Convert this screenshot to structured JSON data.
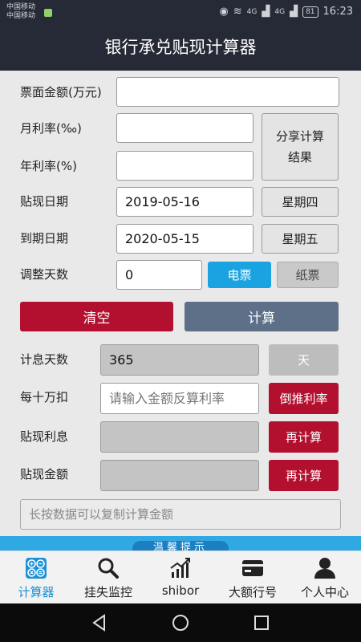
{
  "status_bar": {
    "carrier_1": "中国移动",
    "carrier_2": "中国移动",
    "network_1": "4G",
    "network_2": "4G",
    "battery": "81",
    "time": "16:23"
  },
  "app": {
    "title": "银行承兑贴现计算器"
  },
  "form": {
    "face_amount": {
      "label": "票面金额(万元)",
      "value": ""
    },
    "monthly_rate": {
      "label": "月利率(‰)",
      "value": ""
    },
    "annual_rate": {
      "label": "年利率(%)",
      "value": ""
    },
    "share_button": "分享计算结果",
    "discount_date": {
      "label": "贴现日期",
      "value": "2019-05-16",
      "weekday": "星期四"
    },
    "due_date": {
      "label": "到期日期",
      "value": "2020-05-15",
      "weekday": "星期五"
    },
    "adjust_days": {
      "label": "调整天数",
      "value": "0",
      "e_bill": "电票",
      "paper_bill": "纸票"
    }
  },
  "actions": {
    "clear": "清空",
    "calculate": "计算"
  },
  "results": {
    "interest_days": {
      "label": "计息天数",
      "value": "365",
      "unit": "天"
    },
    "per_100k": {
      "label": "每十万扣",
      "placeholder": "请输入金额反算利率",
      "button": "倒推利率"
    },
    "discount_interest": {
      "label": "贴现利息",
      "value": "",
      "button": "再计算"
    },
    "discount_amount": {
      "label": "贴现金额",
      "value": "",
      "button": "再计算"
    }
  },
  "hint": "长按数据可以复制计算金额",
  "banner": {
    "text": "温馨提示"
  },
  "tabs": [
    {
      "label": "计算器",
      "icon": "calculator-icon"
    },
    {
      "label": "挂失监控",
      "icon": "search-icon"
    },
    {
      "label": "shibor",
      "icon": "chart-icon"
    },
    {
      "label": "大额行号",
      "icon": "card-icon"
    },
    {
      "label": "个人中心",
      "icon": "person-icon"
    }
  ],
  "colors": {
    "header_bg": "#262a36",
    "accent_red": "#b3102f",
    "accent_slate": "#5d7088",
    "accent_blue": "#1aa3e0",
    "tab_active": "#1a90d6"
  }
}
